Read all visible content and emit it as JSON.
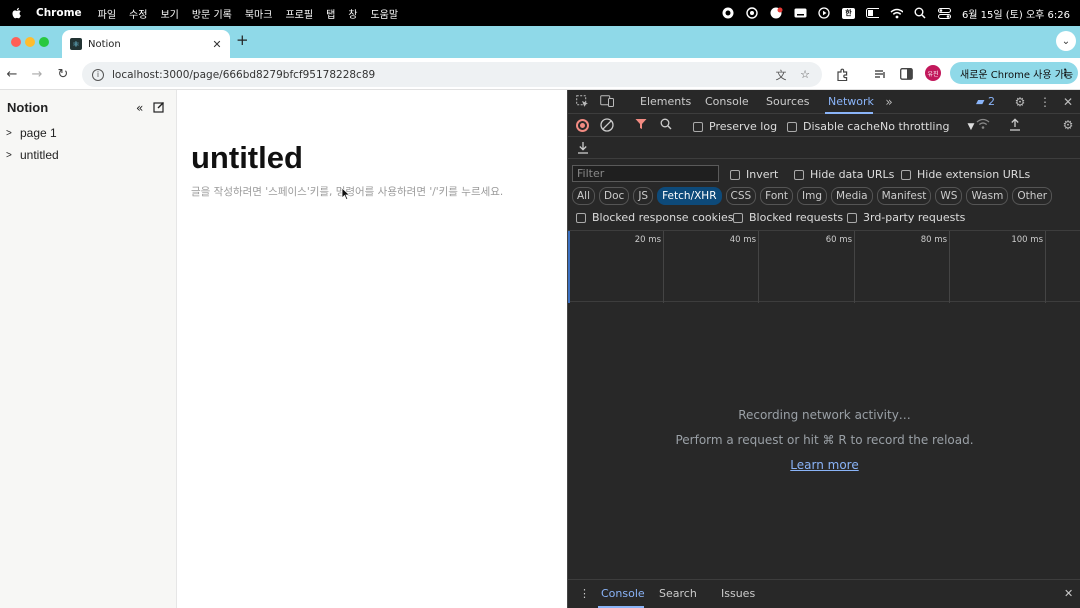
{
  "menubar": {
    "app_name": "Chrome",
    "items": [
      "파일",
      "수정",
      "보기",
      "방문 기록",
      "북마크",
      "프로필",
      "탭",
      "창",
      "도움말"
    ],
    "ime_indicator": "한",
    "datetime": "6월 15일 (토) 오후 6:26"
  },
  "tabs": {
    "active_title": "Notion",
    "favicon_glyph": "⚛",
    "new_tab_label": "+",
    "close_label": "✕"
  },
  "toolbar": {
    "url": "localhost:3000/page/666bd8279bfcf95178228c89",
    "profile_initials": "유진",
    "update_button": "새로운 Chrome 사용 가능",
    "update_more": "⋮"
  },
  "sidebar": {
    "workspace_title": "Notion",
    "pages": [
      {
        "label": "page 1"
      },
      {
        "label": "untitled"
      }
    ]
  },
  "main": {
    "title": "untitled",
    "placeholder": "글을 작성하려면 '스페이스'키를, 명령어를 사용하려면 '/'키를 누르세요."
  },
  "devtools": {
    "tabs": [
      "Elements",
      "Console",
      "Sources",
      "Network"
    ],
    "active_tab": "Network",
    "issues_count": "2",
    "options": {
      "preserve_log": "Preserve log",
      "disable_cache": "Disable cache",
      "throttling": "No throttling"
    },
    "filter_placeholder": "Filter",
    "filter_options": {
      "invert": "Invert",
      "hide_data_urls": "Hide data URLs",
      "hide_extension_urls": "Hide extension URLs"
    },
    "type_chips": [
      "All",
      "Doc",
      "JS",
      "Fetch/XHR",
      "CSS",
      "Font",
      "Img",
      "Media",
      "Manifest",
      "WS",
      "Wasm",
      "Other"
    ],
    "selected_chip": "Fetch/XHR",
    "block_options": {
      "blocked_response_cookies": "Blocked response cookies",
      "blocked_requests": "Blocked requests",
      "third_party": "3rd-party requests"
    },
    "timeline_ticks": [
      "20 ms",
      "40 ms",
      "60 ms",
      "80 ms",
      "100 ms"
    ],
    "empty": {
      "recording": "Recording network activity…",
      "hint": "Perform a request or hit ⌘ R to record the reload.",
      "learn_more": "Learn more"
    },
    "drawer_tabs": [
      "Console",
      "Search",
      "Issues"
    ],
    "drawer_active": "Console"
  },
  "colors": {
    "tabstrip": "#8fd9e8",
    "devtools_bg": "#282828",
    "accent_blue": "#8ab4f8",
    "record_red": "#f28b82",
    "chip_selected": "#0d4a7a"
  }
}
